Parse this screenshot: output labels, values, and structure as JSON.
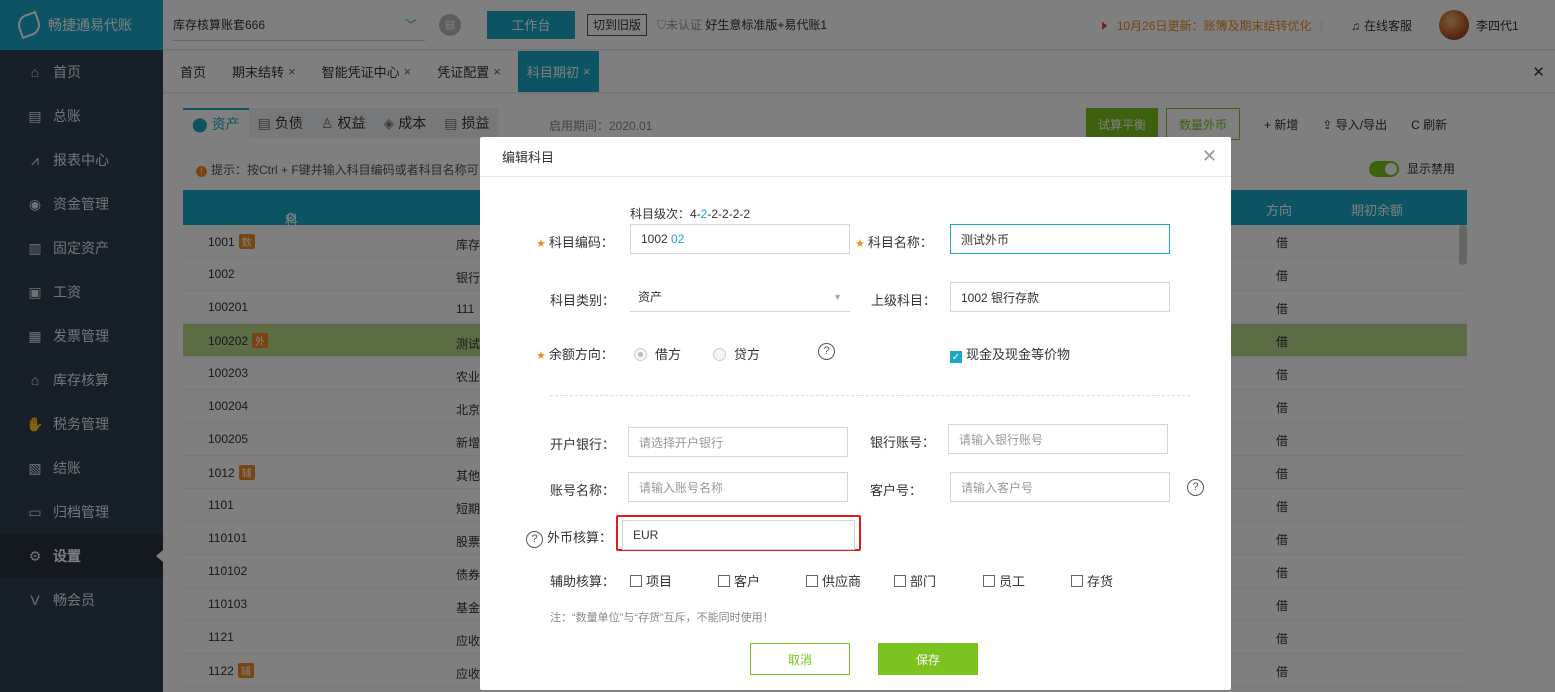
{
  "app": {
    "logo_text": "畅捷通易代账"
  },
  "sidebar": {
    "items": [
      {
        "icon": "home-icon",
        "glyph": "⌂",
        "label": "首页"
      },
      {
        "icon": "ledger-icon",
        "glyph": "▤",
        "label": "总账"
      },
      {
        "icon": "chart-icon",
        "glyph": "⩘",
        "label": "报表中心"
      },
      {
        "icon": "money-icon",
        "glyph": "◉",
        "label": "资金管理"
      },
      {
        "icon": "asset-icon",
        "glyph": "▥",
        "label": "固定资产"
      },
      {
        "icon": "salary-icon",
        "glyph": "▣",
        "label": "工资"
      },
      {
        "icon": "invoice-icon",
        "glyph": "▦",
        "label": "发票管理"
      },
      {
        "icon": "inventory-icon",
        "glyph": "⌂",
        "label": "库存核算"
      },
      {
        "icon": "tax-icon",
        "glyph": "✋",
        "label": "税务管理"
      },
      {
        "icon": "close-account-icon",
        "glyph": "▧",
        "label": "结账"
      },
      {
        "icon": "archive-icon",
        "glyph": "▭",
        "label": "归档管理"
      },
      {
        "icon": "gear-icon",
        "glyph": "⚙",
        "label": "设置"
      },
      {
        "icon": "vip-icon",
        "glyph": "V",
        "label": "畅会员"
      }
    ]
  },
  "topbar": {
    "ledger": "库存核算账套666",
    "workbench": "工作台",
    "switch_old": "切到旧版",
    "verify": "未认证",
    "edition": "好生意标准版+易代账1",
    "notice": "10月26日更新：账簿及期末结转优化",
    "service": "在线客服",
    "username": "李四代1"
  },
  "tabs": [
    {
      "label": "首页",
      "closable": ""
    },
    {
      "label": "期末结转",
      "closable": "×"
    },
    {
      "label": "智能凭证中心",
      "closable": "×"
    },
    {
      "label": "凭证配置",
      "closable": "×"
    },
    {
      "label": "科目期初",
      "closable": "×"
    }
  ],
  "content": {
    "subtabs": [
      {
        "glyph": "⬤",
        "label": "资产"
      },
      {
        "glyph": "▤",
        "label": "负债"
      },
      {
        "glyph": "♙",
        "label": "权益"
      },
      {
        "glyph": "◈",
        "label": "成本"
      },
      {
        "glyph": "▤",
        "label": "损益"
      }
    ],
    "period": "启用期间：2020.01",
    "trial_balance": "试算平衡",
    "qty_fx": "数量外币",
    "add": "+ 新增",
    "import_export": "导入/导出",
    "refresh": "C 刷新",
    "hint": "提示：按Ctrl + F键并输入科目编码或者科目名称可",
    "show_disabled": "显示禁用",
    "col_code": "科目编码",
    "col_dir": "方向",
    "col_balance": "期初余额",
    "rows": [
      {
        "code": "1001",
        "tag": "数",
        "name": "库存",
        "dir": "借"
      },
      {
        "code": "1002",
        "tag": "",
        "name": "银行",
        "dir": "借"
      },
      {
        "code": "100201",
        "tag": "",
        "name": "111",
        "dir": "借"
      },
      {
        "code": "100202",
        "tag": "外",
        "name": "测试",
        "dir": "借"
      },
      {
        "code": "100203",
        "tag": "",
        "name": "农业",
        "dir": "借"
      },
      {
        "code": "100204",
        "tag": "",
        "name": "北京",
        "dir": "借"
      },
      {
        "code": "100205",
        "tag": "",
        "name": "新增",
        "dir": "借"
      },
      {
        "code": "1012",
        "tag": "辅",
        "name": "其他",
        "dir": "借"
      },
      {
        "code": "1101",
        "tag": "",
        "name": "短期",
        "dir": "借"
      },
      {
        "code": "110101",
        "tag": "",
        "name": "股票",
        "dir": "借"
      },
      {
        "code": "110102",
        "tag": "",
        "name": "债券",
        "dir": "借"
      },
      {
        "code": "110103",
        "tag": "",
        "name": "基金",
        "dir": "借"
      },
      {
        "code": "1121",
        "tag": "",
        "name": "应收",
        "dir": "借"
      },
      {
        "code": "1122",
        "tag": "辅",
        "name": "应收",
        "dir": "借"
      }
    ]
  },
  "modal": {
    "title": "编辑科目",
    "level_hint_prefix": "科目级次：4-",
    "level_hint_blue": "2",
    "level_hint_suffix": "-2-2-2-2",
    "code_label": "科目编码：",
    "code_prefix": "1002",
    "code_suffix": "02",
    "name_label": "科目名称：",
    "name_value": "测试外币",
    "type_label": "科目类别：",
    "type_value": "资产",
    "parent_label": "上级科目：",
    "parent_value": "1002 银行存款",
    "direction_label": "余额方向：",
    "debit": "借方",
    "credit": "贷方",
    "cash_equiv": "现金及现金等价物",
    "bank_label": "开户银行：",
    "bank_placeholder": "请选择开户银行",
    "account_no_label": "银行账号：",
    "account_no_placeholder": "请输入银行账号",
    "account_name_label": "账号名称：",
    "account_name_placeholder": "请输入账号名称",
    "customer_no_label": "客户号：",
    "customer_no_placeholder": "请输入客户号",
    "fx_label": "外币核算：",
    "fx_value": "EUR",
    "aux_label": "辅助核算：",
    "aux_options": [
      "项目",
      "客户",
      "供应商",
      "部门",
      "员工",
      "存货"
    ],
    "note": "注：“数量单位”与“存货”互斥，不能同时使用！",
    "cancel": "取消",
    "save": "保存"
  }
}
